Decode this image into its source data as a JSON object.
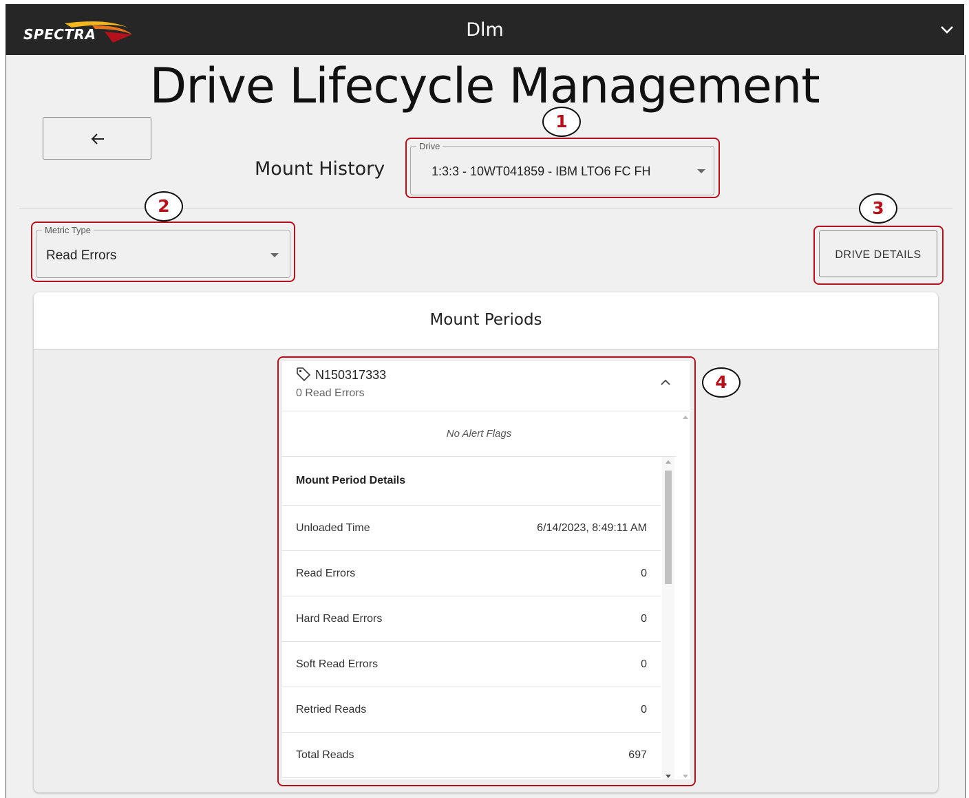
{
  "app": {
    "logo_text": "SPECTRA",
    "title": "Dlm",
    "icons": {
      "menu": "chevron-down-icon",
      "back": "arrow-left-icon"
    }
  },
  "page": {
    "title": "Drive Lifecycle Management",
    "subtitle": "Mount History"
  },
  "drive_select": {
    "label": "Drive",
    "value": "1:3:3 - 10WT041859 - IBM LTO6 FC FH"
  },
  "metric_select": {
    "label": "Metric Type",
    "value": "Read Errors"
  },
  "drive_details_button": "DRIVE DETAILS",
  "callouts": [
    "1",
    "2",
    "3",
    "4"
  ],
  "mount_periods": {
    "title": "Mount Periods",
    "entry": {
      "tape_id": "N150317333",
      "summary": "0 Read Errors",
      "alert_text": "No Alert Flags",
      "details_heading": "Mount Period Details",
      "details": [
        {
          "label": "Unloaded Time",
          "value": "6/14/2023, 8:49:11 AM"
        },
        {
          "label": "Read Errors",
          "value": "0"
        },
        {
          "label": "Hard Read Errors",
          "value": "0"
        },
        {
          "label": "Soft Read Errors",
          "value": "0"
        },
        {
          "label": "Retried Reads",
          "value": "0"
        },
        {
          "label": "Total Reads",
          "value": "697"
        }
      ]
    }
  },
  "colors": {
    "appbar": "#262626",
    "highlight": "#b3121d",
    "logo_swoosh": [
      "#f2b51d",
      "#e4731b",
      "#b3121d"
    ]
  }
}
